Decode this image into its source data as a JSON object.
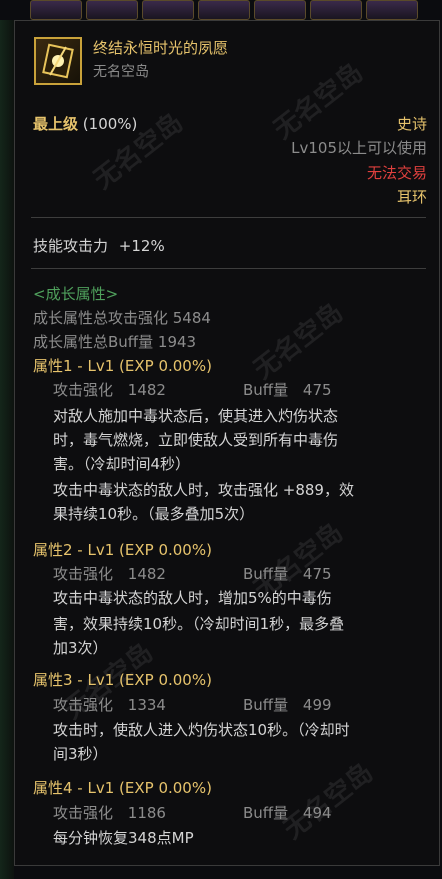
{
  "item": {
    "name": "终结永恒时光的夙愿",
    "source": "无名空岛",
    "grade_label": "最上级",
    "grade_value": "(100%)",
    "rarity": "史诗",
    "level_req": "Lv105以上可以使用",
    "trade": "无法交易",
    "slot": "耳环",
    "skill_attack_label": "技能攻击力",
    "skill_attack_value": "+12%"
  },
  "growth": {
    "header": "<成长属性>",
    "total_attack": "成长属性总攻击强化 5484",
    "total_buff": "成长属性总Buff量 1943",
    "attributes": [
      {
        "title": "属性1 - Lv1 (EXP 0.00%)",
        "atk_label": "攻击强化",
        "atk_value": "1482",
        "buff_label": "Buff量",
        "buff_value": "475",
        "desc": [
          "对敌人施加中毒状态后，使其进入灼伤状态",
          "时，毒气燃烧，立即使敌人受到所有中毒伤",
          "害。（冷却时间4秒）",
          "攻击中毒状态的敌人时，攻击强化 +889，效",
          "果持续10秒。（最多叠加5次）"
        ]
      },
      {
        "title": "属性2 - Lv1 (EXP 0.00%)",
        "atk_label": "攻击强化",
        "atk_value": "1482",
        "buff_label": "Buff量",
        "buff_value": "475",
        "desc": [
          "攻击中毒状态的敌人时，增加5%的中毒伤",
          "害，效果持续10秒。（冷却时间1秒，最多叠",
          "加3次）"
        ]
      },
      {
        "title": "属性3 - Lv1 (EXP 0.00%)",
        "atk_label": "攻击强化",
        "atk_value": "1334",
        "buff_label": "Buff量",
        "buff_value": "499",
        "desc": [
          "攻击时，使敌人进入灼伤状态10秒。（冷却时",
          "间3秒）"
        ]
      },
      {
        "title": "属性4 - Lv1 (EXP 0.00%)",
        "atk_label": "攻击强化",
        "atk_value": "1186",
        "buff_label": "Buff量",
        "buff_value": "494",
        "desc": [
          "每分钟恢复348点MP"
        ]
      }
    ]
  },
  "watermark": "无名空岛",
  "colors": {
    "gold": "#e6c36c",
    "red": "#e0403e",
    "green": "#4fa05c",
    "grey": "#8c8c8c"
  }
}
